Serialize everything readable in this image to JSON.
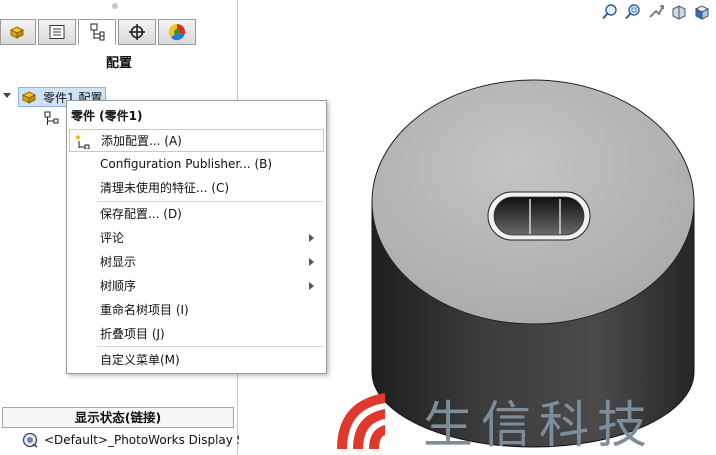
{
  "panel": {
    "title": "配置",
    "tabs": [
      {
        "name": "feature-manager"
      },
      {
        "name": "property-manager"
      },
      {
        "name": "configuration-manager"
      },
      {
        "name": "dimxpert-manager"
      },
      {
        "name": "display-manager"
      }
    ],
    "tree_root": "零件1 配置",
    "display_state_header": "显示状态(链接)",
    "display_state_item": "<Default>_PhotoWorks Display S"
  },
  "menu": {
    "header": "零件 (零件1)",
    "items": [
      {
        "label": "添加配置... (A)",
        "highlighted": true,
        "icon": "add-configuration-icon"
      },
      {
        "label": "Configuration Publisher... (B)"
      },
      {
        "label": "清理未使用的特征... (C)"
      },
      {
        "label": "保存配置... (D)"
      },
      {
        "label": "评论",
        "submenu": true
      },
      {
        "label": "树显示",
        "submenu": true
      },
      {
        "label": "树顺序",
        "submenu": true
      },
      {
        "label": "重命名树项目 (I)"
      },
      {
        "label": "折叠项目 (J)"
      },
      {
        "label": "自定义菜单(M)"
      }
    ]
  },
  "watermark": {
    "text": "生信科技"
  },
  "colors": {
    "accent_red": "#e0382a",
    "selection": "#cfe3f7",
    "model_top": "#b9b9b9",
    "model_side": "#2f2f2f"
  },
  "icons": [
    "zoom-to-fit-icon",
    "zoom-area-icon",
    "previous-view-icon",
    "section-view-icon",
    "view-orientation-icon"
  ]
}
